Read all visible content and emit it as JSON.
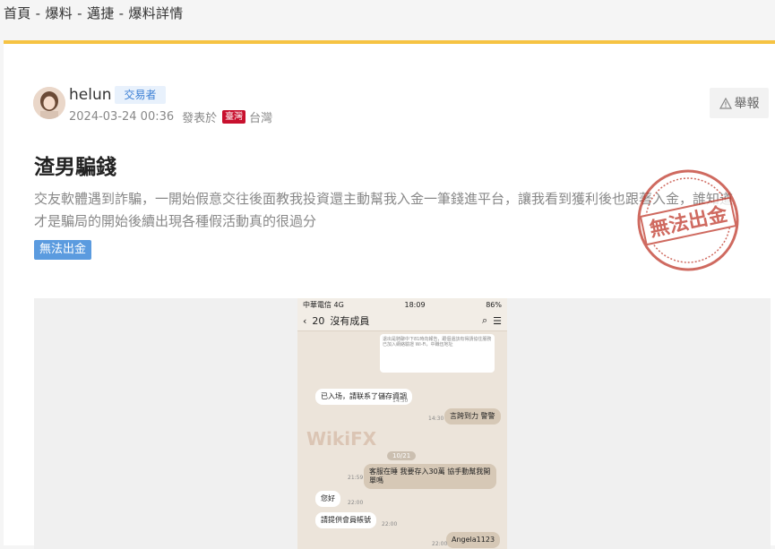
{
  "breadcrumb": {
    "items": [
      "首頁",
      "爆料",
      "邁捷",
      "爆料詳情"
    ],
    "separator": " - "
  },
  "author": {
    "name": "helun",
    "role": "交易者",
    "datetime": "2024-03-24 00:36",
    "posted_in": "發表於",
    "region_flag": "臺灣",
    "region": "台灣"
  },
  "report_label": "舉報",
  "post": {
    "title": "渣男騙錢",
    "body": "交友軟體遇到詐騙，一開始假意交往後面教我投資還主動幫我入金一筆錢進平台，讓我看到獲利後也跟著入金，誰知道才是騙局的開始後續出現各種假活動真的很過分",
    "tag": "無法出金"
  },
  "stamp_text": "無法出金",
  "screenshot": {
    "status": {
      "carrier": "中華電信 4G",
      "time": "18:09",
      "battery": "86%"
    },
    "header": {
      "back": "20",
      "title": "沒有成員",
      "search_icon": "search-icon",
      "menu_icon": "menu-icon"
    },
    "watermark": "WikiFX",
    "date_chip": "10/21",
    "messages": [
      {
        "text": "已入场，請联系了儲存資調",
        "time": "14:30"
      },
      {
        "text": "言跨到力 警警",
        "time": "14:30"
      },
      {
        "text": "客服在睡 我要存入30萬 協手動幫我開單嗎",
        "time": "21:59"
      },
      {
        "text": "您好",
        "time": "22:00"
      },
      {
        "text": "請提供會員帳號",
        "time": "22:00"
      },
      {
        "text": "Angela1123",
        "time": "22:00"
      }
    ],
    "quoted_text": "退出是騎聊中下81時向報告，跟個還該有得請協住服務已加入網絡驗證 Wi-Fi，中職伍地址"
  },
  "colors": {
    "accent_bar": "#f6c343",
    "badge_blue": "#5b9bdf",
    "flag_red": "#c8102e",
    "stamp_red": "#c0392b"
  }
}
